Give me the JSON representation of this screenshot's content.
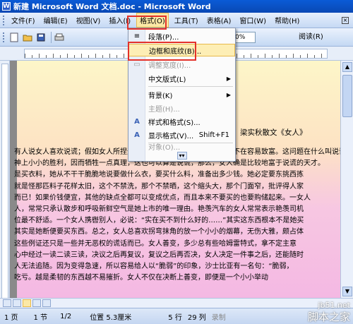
{
  "window": {
    "title": "新建 Microsoft Word 文档.doc - Microsoft Word",
    "app_icon": "W"
  },
  "menubar": {
    "items": [
      "文件(F)",
      "编辑(E)",
      "视图(V)",
      "插入(I)",
      "格式(O)",
      "工具(T)",
      "表格(A)",
      "窗口(W)",
      "帮助(H)"
    ],
    "help_icon": "×"
  },
  "toolbar": {
    "zoom": "0%",
    "reading": "阅读(R)"
  },
  "format_menu": {
    "items": [
      {
        "label": "段落(P)...",
        "icon": "paragraph-icon"
      },
      {
        "label": "边框和底纹(B)...",
        "icon": "borders-icon"
      },
      {
        "label": "调整宽度(I)...",
        "icon": "fit-width-icon"
      },
      {
        "label": "中文版式(L)",
        "icon": ""
      },
      {
        "label": "背景(K)",
        "icon": ""
      },
      {
        "label": "主题(H)...",
        "icon": ""
      },
      {
        "label": "样式和格式(S)...",
        "icon": "styles-icon"
      },
      {
        "label": "显示格式(V)...",
        "icon": "reveal-format-icon",
        "shortcut": "Shift+F1"
      },
      {
        "label": "对象(O)...",
        "icon": ""
      }
    ]
  },
  "document": {
    "title": "梁实秋散文《女人》",
    "lines": [
      "有人说女人喜欢说谎；假如女人所捏造的故事都能登记下来，其分量当不在容易致富。这问题在什么叫说谎",
      "神上小小的胜利，因而牺牲一点真理，这也可以算是说谎，那么，女人确是比较地富于说谎的天才。",
      "是买衣料，她从不干干脆脆地说要做什么衣，要买什么料，准备出多少钱。她必定要东挑西拣",
      "就是怪那匹料子花样太旧，这个不禁洗，那个不禁晒，这个缩头大，那个门面窄，批评得人家",
      "而已！如果价钱便宜，其他的缺点全都可以变成优点，而且本来不要买的也要购储起来。一女人",
      "人，常常只承认散步和呼吸新鲜空气是她上市的唯一理由。艳羡汽车的女人常常表示艳羡司机",
      "位最不舒适。一个女人携辔别人，必说：“实在买不到什么好的……”其实这东西根本不是她买",
      "其实是她断便要买东西。总之，女人总喜欢拐弯抹角的放一个小小的烟幕，无伤大雅，颇占体",
      "这些例证还只是一些并无恶权的谎话而已。女人善变，多少总有些哈姆雷特式，拿不定主意",
      "心中经过一读二读三读，决议之后再复议，复议之后再否决，女人决定一件事之后，还能随时",
      "人无法追随。因为变得急速，所以容易给人以“脆弱”的印象，沙士比亚有一名句：“脆弱，",
      "吃亏。越是柔韧的东西越不易摧折。女人不仅在决断上善变，即便是一个小小举动"
    ]
  },
  "status": {
    "page": "1 页",
    "section": "1 节",
    "pages": "1/2",
    "position": "位置 5.3厘米",
    "line": "5 行",
    "col": "29 列",
    "rec": "录制"
  },
  "watermark": {
    "text": "脚本之家",
    "url": "jb51.net"
  },
  "colors": {
    "highlight_border": "#e3312a",
    "menu_hover": "#fdeeb5",
    "title_bar": "#0a5bd6"
  }
}
